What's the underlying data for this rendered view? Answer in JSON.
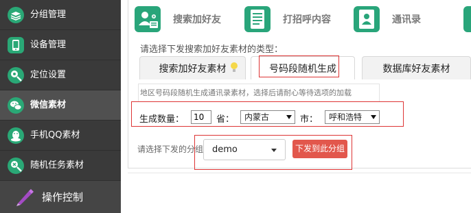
{
  "sidebar": {
    "items": [
      {
        "label": "分组管理",
        "icon": "layers-icon"
      },
      {
        "label": "设备管理",
        "icon": "phone-icon"
      },
      {
        "label": "定位设置",
        "icon": "location-icon"
      },
      {
        "label": "微信素材",
        "icon": "wechat-icon"
      },
      {
        "label": "手机QQ素材",
        "icon": "qq-icon"
      },
      {
        "label": "随机任务素材",
        "icon": "shuffle-icon"
      }
    ],
    "bottom_label": "操作控制",
    "bottom_icon": "pen-icon"
  },
  "top_tabs": [
    {
      "label": "搜索加好友",
      "icon": "add-user-icon"
    },
    {
      "label": "打招呼内容",
      "icon": "document-icon"
    },
    {
      "label": "通讯录",
      "icon": "contacts-icon"
    }
  ],
  "type_prompt": "请选择下发搜索加好友素材的类型：",
  "sub_tabs": [
    {
      "label": "搜索加好友素材"
    },
    {
      "label": "号码段随机生成"
    },
    {
      "label": "数据库好友素材"
    }
  ],
  "description": "地区号码段随机生成通讯录素材，选择后请耐心等待选项的加载",
  "form": {
    "count_label": "生成数量：",
    "count_value": "10",
    "province_label": "省：",
    "province_value": "内蒙古",
    "city_label": "市：",
    "city_value": "呼和浩特"
  },
  "group": {
    "label": "请选择下发的分组",
    "selected": "demo",
    "send_button": "下发到此分组"
  },
  "colors": {
    "sidebar_bg": "#3a3a3a",
    "accent_green": "#29a57a",
    "send_button": "#e2574c",
    "highlight_red": "#dd3333"
  }
}
